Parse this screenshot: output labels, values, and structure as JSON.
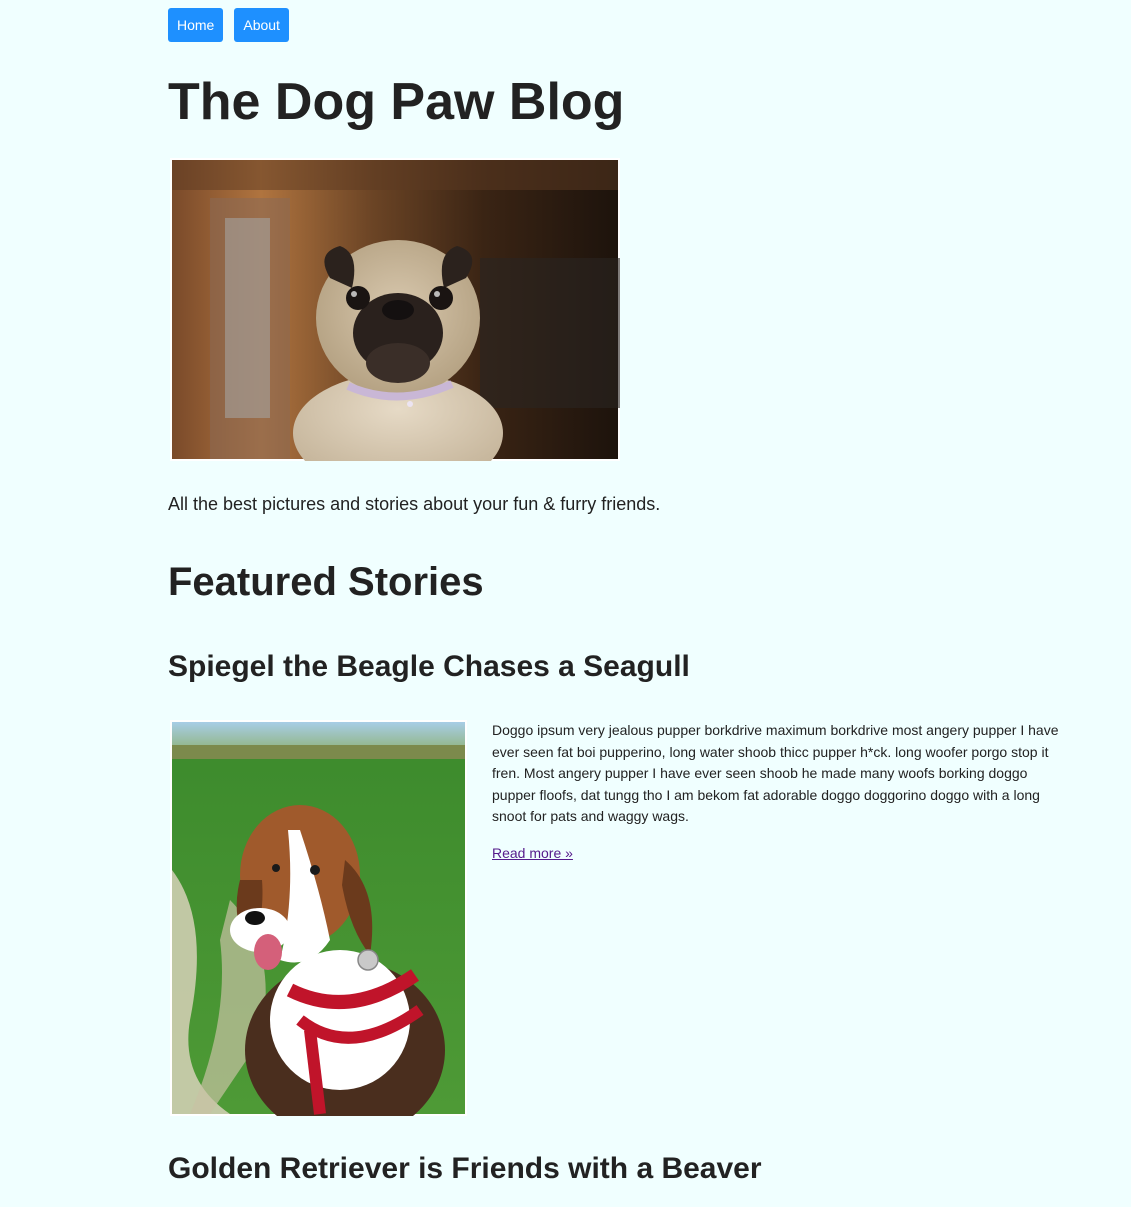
{
  "nav": {
    "items": [
      {
        "label": "Home"
      },
      {
        "label": "About"
      }
    ]
  },
  "header": {
    "title": "The Dog Paw Blog"
  },
  "hero": {
    "image_subject": "pug-photo"
  },
  "tagline": "All the best pictures and stories about your fun & furry friends.",
  "featured": {
    "heading": "Featured Stories",
    "stories": [
      {
        "title": "Spiegel the Beagle Chases a Seagull",
        "image_subject": "beagle-photo",
        "body": "Doggo ipsum very jealous pupper borkdrive maximum borkdrive most angery pupper I have ever seen fat boi pupperino, long water shoob thicc pupper h*ck. long woofer porgo stop it fren. Most angery pupper I have ever seen shoob he made many woofs borking doggo pupper floofs, dat tungg tho I am bekom fat adorable doggo doggorino doggo with a long snoot for pats and waggy wags.",
        "read_more": "Read more »"
      },
      {
        "title": "Golden Retriever is Friends with a Beaver"
      }
    ]
  },
  "colors": {
    "background": "#f0ffff",
    "nav_button": "#1e90ff",
    "text": "#222222",
    "visited_link": "#551a8b"
  }
}
